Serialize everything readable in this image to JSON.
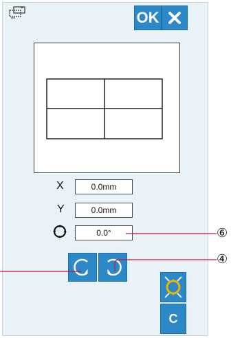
{
  "toolbar": {
    "ok_label": "OK",
    "close_icon": "close-icon",
    "mode_icon": "pattern-adjust-icon"
  },
  "fields": {
    "x_label": "X",
    "x_value": "0.0mm",
    "y_label": "Y",
    "y_value": "0.0mm",
    "angle_value": "0.0°"
  },
  "controls": {
    "rotate_ccw_icon": "rotate-counterclockwise-icon",
    "rotate_cw_icon": "rotate-clockwise-icon",
    "center_icon": "center-position-icon",
    "clear_label": "C"
  },
  "callouts": {
    "six": "⑥",
    "four": "④"
  },
  "colors": {
    "button_blue": "#2c88c6",
    "screen_bg": "#e9f2f6",
    "callout_line": "#c0143c",
    "accent_yellow": "#f0b400"
  }
}
